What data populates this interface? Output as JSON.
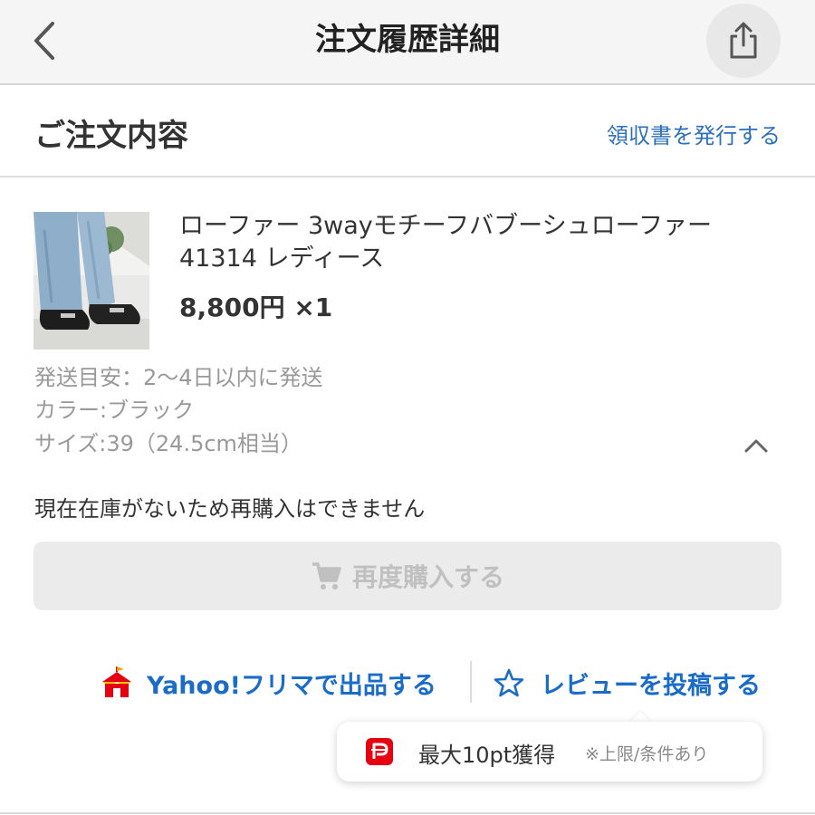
{
  "header": {
    "title": "注文履歴詳細",
    "back_icon": "chevron-left-icon",
    "share_icon": "share-icon"
  },
  "order": {
    "section_title": "ご注文内容",
    "receipt_link": "領収書を発行する"
  },
  "product": {
    "name_line1": "ローファー 3wayモチーフバブーシュローファー",
    "name_line2": "41314 レディース",
    "price": "8,800円",
    "quantity": "×1",
    "shipping": "発送目安：2〜4日以内に発送",
    "color": "カラー:ブラック",
    "size": "サイズ:39（24.5cm相当）"
  },
  "stock_note": "現在在庫がないため再購入はできません",
  "rebuy": {
    "label": "再度購入する",
    "icon": "cart-icon"
  },
  "actions": {
    "flea_label": "Yahoo!フリマで出品する",
    "flea_icon": "tent-icon",
    "review_label": "レビューを投稿する",
    "review_icon": "star-icon"
  },
  "points_bubble": {
    "main": "最大10pt獲得",
    "note": "※上限/条件あり",
    "icon": "paypay-icon"
  },
  "colors": {
    "link_blue": "#1a6cc8",
    "paypay_red": "#e50012",
    "disabled_gray": "#c0c0c0"
  }
}
